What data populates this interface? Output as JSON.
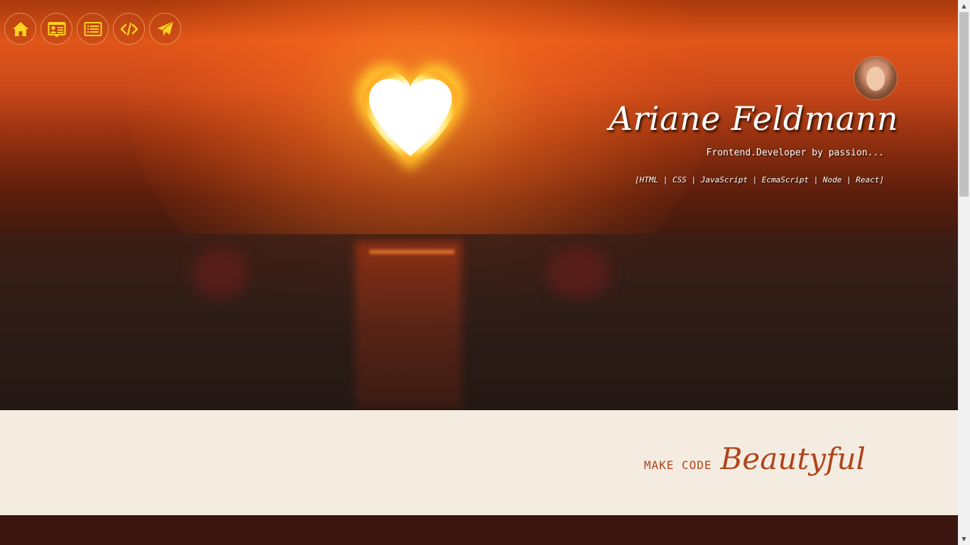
{
  "nav": {
    "items": [
      {
        "icon": "home-icon",
        "color": "#ffd21f"
      },
      {
        "icon": "contact-card-icon",
        "color": "#ffd21f"
      },
      {
        "icon": "list-icon",
        "color": "#ffd21f"
      },
      {
        "icon": "code-icon",
        "color": "#ffd21f"
      },
      {
        "icon": "paper-plane-icon",
        "color": "#ffd21f"
      }
    ]
  },
  "profile": {
    "name": "Ariane Feldmann",
    "tagline": "Frontend.Developer by passion...",
    "skills": "[HTML | CSS | JavaScript | EcmaScript | Node | React]"
  },
  "slogan": {
    "small": "MAKE CODE",
    "big": "Beautyful"
  },
  "colors": {
    "accent": "#b0441b",
    "icon": "#ffd21f",
    "band": "#f4ece1",
    "footer": "#3c1510"
  }
}
